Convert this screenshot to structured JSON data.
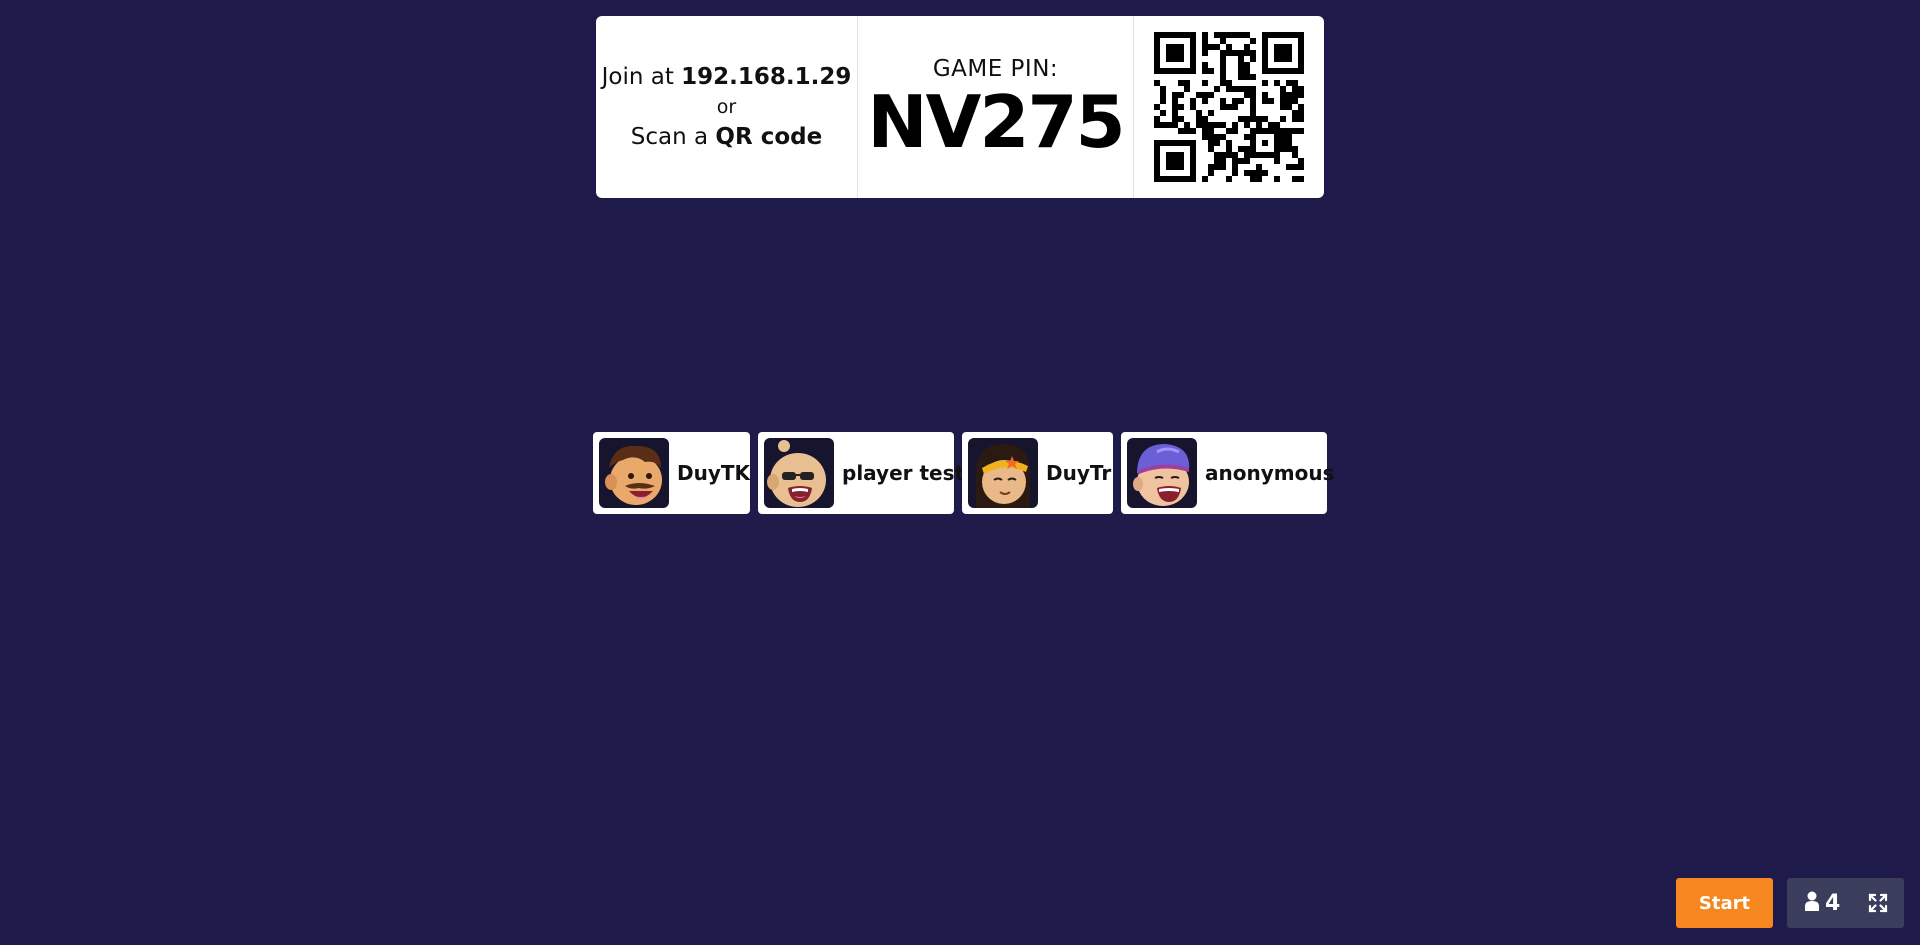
{
  "join": {
    "prefix": "Join at ",
    "address": "192.168.1.29",
    "or": "or",
    "scan_prefix": "Scan a ",
    "scan_strong": "QR code"
  },
  "pin": {
    "label": "GAME PIN:",
    "value": "NV275"
  },
  "players": [
    {
      "name": "DuyTK",
      "avatar": "mustache-man-avatar"
    },
    {
      "name": "player test",
      "avatar": "bald-sunglasses-avatar"
    },
    {
      "name": "DuyTr",
      "avatar": "headband-girl-avatar"
    },
    {
      "name": "anonymous",
      "avatar": "purple-hair-avatar"
    }
  ],
  "controls": {
    "start_label": "Start",
    "player_count": "4",
    "person_icon": "person-icon",
    "fullscreen_icon": "fullscreen-icon"
  },
  "colors": {
    "background": "#1e1a4a",
    "start": "#f6861f",
    "count_panel": "#3a3d5c"
  }
}
